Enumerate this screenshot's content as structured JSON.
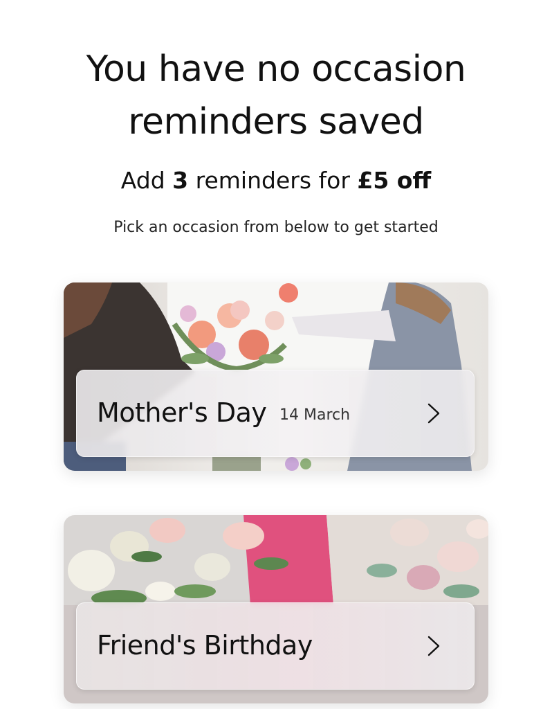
{
  "header": {
    "title_line1": "You have no occasion",
    "title_line2": "reminders saved"
  },
  "offer": {
    "prefix": "Add ",
    "count": "3",
    "middle": " reminders for ",
    "discount": "£5 off"
  },
  "hint": "Pick an occasion from below to get started",
  "occasions": [
    {
      "title": "Mother's Day",
      "date": "14 March",
      "icon": "chevron-right-icon"
    },
    {
      "title": "Friend's Birthday",
      "date": "",
      "icon": "chevron-right-icon"
    }
  ]
}
